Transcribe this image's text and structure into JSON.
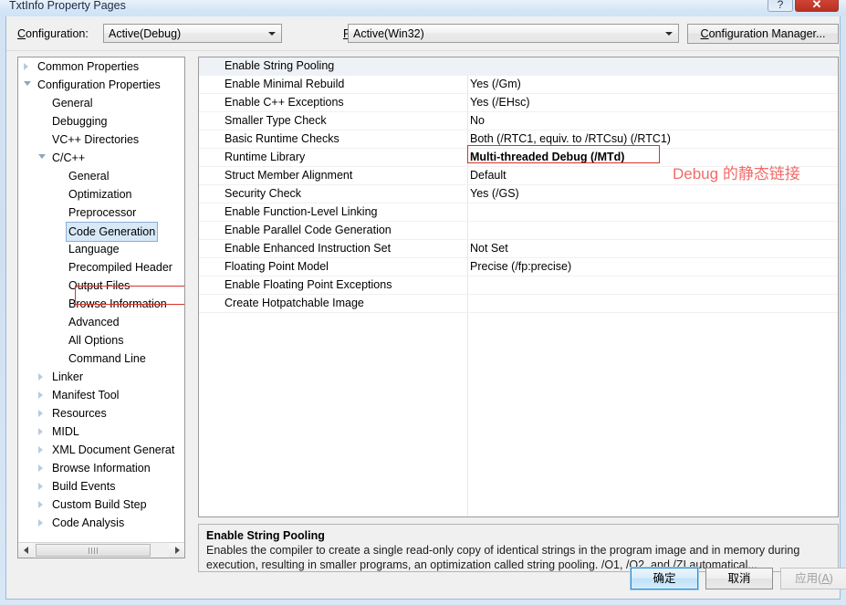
{
  "window": {
    "title": "TxtInfo Property Pages",
    "caption_buttons": [
      {
        "name": "help-button",
        "glyph": "?"
      },
      {
        "name": "close-button",
        "glyph": "✕"
      }
    ]
  },
  "toolbar": {
    "configuration_label": "Configuration:",
    "configuration_value": "Active(Debug)",
    "platform_label": "Platform:",
    "platform_value": "Active(Win32)",
    "configuration_manager_label": "Configuration Manager..."
  },
  "tree": {
    "items": [
      {
        "label": "Common Properties",
        "indent": 0,
        "expander": "collapsed",
        "selected": false
      },
      {
        "label": "Configuration Properties",
        "indent": 0,
        "expander": "expanded",
        "selected": false
      },
      {
        "label": "General",
        "indent": 1,
        "expander": "none",
        "selected": false
      },
      {
        "label": "Debugging",
        "indent": 1,
        "expander": "none",
        "selected": false
      },
      {
        "label": "VC++ Directories",
        "indent": 1,
        "expander": "none",
        "selected": false
      },
      {
        "label": "C/C++",
        "indent": 1,
        "expander": "expanded",
        "selected": false
      },
      {
        "label": "General",
        "indent": 2,
        "expander": "none",
        "selected": false
      },
      {
        "label": "Optimization",
        "indent": 2,
        "expander": "none",
        "selected": false
      },
      {
        "label": "Preprocessor",
        "indent": 2,
        "expander": "none",
        "selected": false
      },
      {
        "label": "Code Generation",
        "indent": 2,
        "expander": "none",
        "selected": true
      },
      {
        "label": "Language",
        "indent": 2,
        "expander": "none",
        "selected": false
      },
      {
        "label": "Precompiled Header",
        "indent": 2,
        "expander": "none",
        "selected": false
      },
      {
        "label": "Output Files",
        "indent": 2,
        "expander": "none",
        "selected": false
      },
      {
        "label": "Browse Information",
        "indent": 2,
        "expander": "none",
        "selected": false
      },
      {
        "label": "Advanced",
        "indent": 2,
        "expander": "none",
        "selected": false
      },
      {
        "label": "All Options",
        "indent": 2,
        "expander": "none",
        "selected": false
      },
      {
        "label": "Command Line",
        "indent": 2,
        "expander": "none",
        "selected": false
      },
      {
        "label": "Linker",
        "indent": 1,
        "expander": "collapsed",
        "selected": false
      },
      {
        "label": "Manifest Tool",
        "indent": 1,
        "expander": "collapsed",
        "selected": false
      },
      {
        "label": "Resources",
        "indent": 1,
        "expander": "collapsed",
        "selected": false
      },
      {
        "label": "MIDL",
        "indent": 1,
        "expander": "collapsed",
        "selected": false
      },
      {
        "label": "XML Document Generat",
        "indent": 1,
        "expander": "collapsed",
        "selected": false
      },
      {
        "label": "Browse Information",
        "indent": 1,
        "expander": "collapsed",
        "selected": false
      },
      {
        "label": "Build Events",
        "indent": 1,
        "expander": "collapsed",
        "selected": false
      },
      {
        "label": "Custom Build Step",
        "indent": 1,
        "expander": "collapsed",
        "selected": false
      },
      {
        "label": "Code Analysis",
        "indent": 1,
        "expander": "collapsed",
        "selected": false
      }
    ]
  },
  "properties": {
    "rows": [
      {
        "name": "Enable String Pooling",
        "value": "",
        "selected": true,
        "highlight": false
      },
      {
        "name": "Enable Minimal Rebuild",
        "value": "Yes (/Gm)",
        "selected": false,
        "highlight": false
      },
      {
        "name": "Enable C++ Exceptions",
        "value": "Yes (/EHsc)",
        "selected": false,
        "highlight": false
      },
      {
        "name": "Smaller Type Check",
        "value": "No",
        "selected": false,
        "highlight": false
      },
      {
        "name": "Basic Runtime Checks",
        "value": "Both (/RTC1, equiv. to /RTCsu) (/RTC1)",
        "selected": false,
        "highlight": false
      },
      {
        "name": "Runtime Library",
        "value": "Multi-threaded Debug (/MTd)",
        "selected": false,
        "highlight": true
      },
      {
        "name": "Struct Member Alignment",
        "value": "Default",
        "selected": false,
        "highlight": false
      },
      {
        "name": "Security Check",
        "value": "Yes (/GS)",
        "selected": false,
        "highlight": false
      },
      {
        "name": "Enable Function-Level Linking",
        "value": "",
        "selected": false,
        "highlight": false
      },
      {
        "name": "Enable Parallel Code Generation",
        "value": "",
        "selected": false,
        "highlight": false
      },
      {
        "name": "Enable Enhanced Instruction Set",
        "value": "Not Set",
        "selected": false,
        "highlight": false
      },
      {
        "name": "Floating Point Model",
        "value": "Precise (/fp:precise)",
        "selected": false,
        "highlight": false
      },
      {
        "name": "Enable Floating Point Exceptions",
        "value": "",
        "selected": false,
        "highlight": false
      },
      {
        "name": "Create Hotpatchable Image",
        "value": "",
        "selected": false,
        "highlight": false
      }
    ]
  },
  "annotation": {
    "text": "Debug 的静态链接",
    "color": "#f16b68"
  },
  "description": {
    "title": "Enable String Pooling",
    "body": "Enables the compiler to create a single read-only copy of identical strings in the program image and in memory during execution, resulting in smaller programs, an optimization called string pooling. /O1, /O2, and /ZI  automatical..."
  },
  "buttons": {
    "ok": "确定",
    "cancel": "取消",
    "apply_prefix": "应用(",
    "apply_key": "A",
    "apply_suffix": ")"
  },
  "scrollbar": {
    "left_arrow": "◄",
    "right_arrow": "►"
  }
}
